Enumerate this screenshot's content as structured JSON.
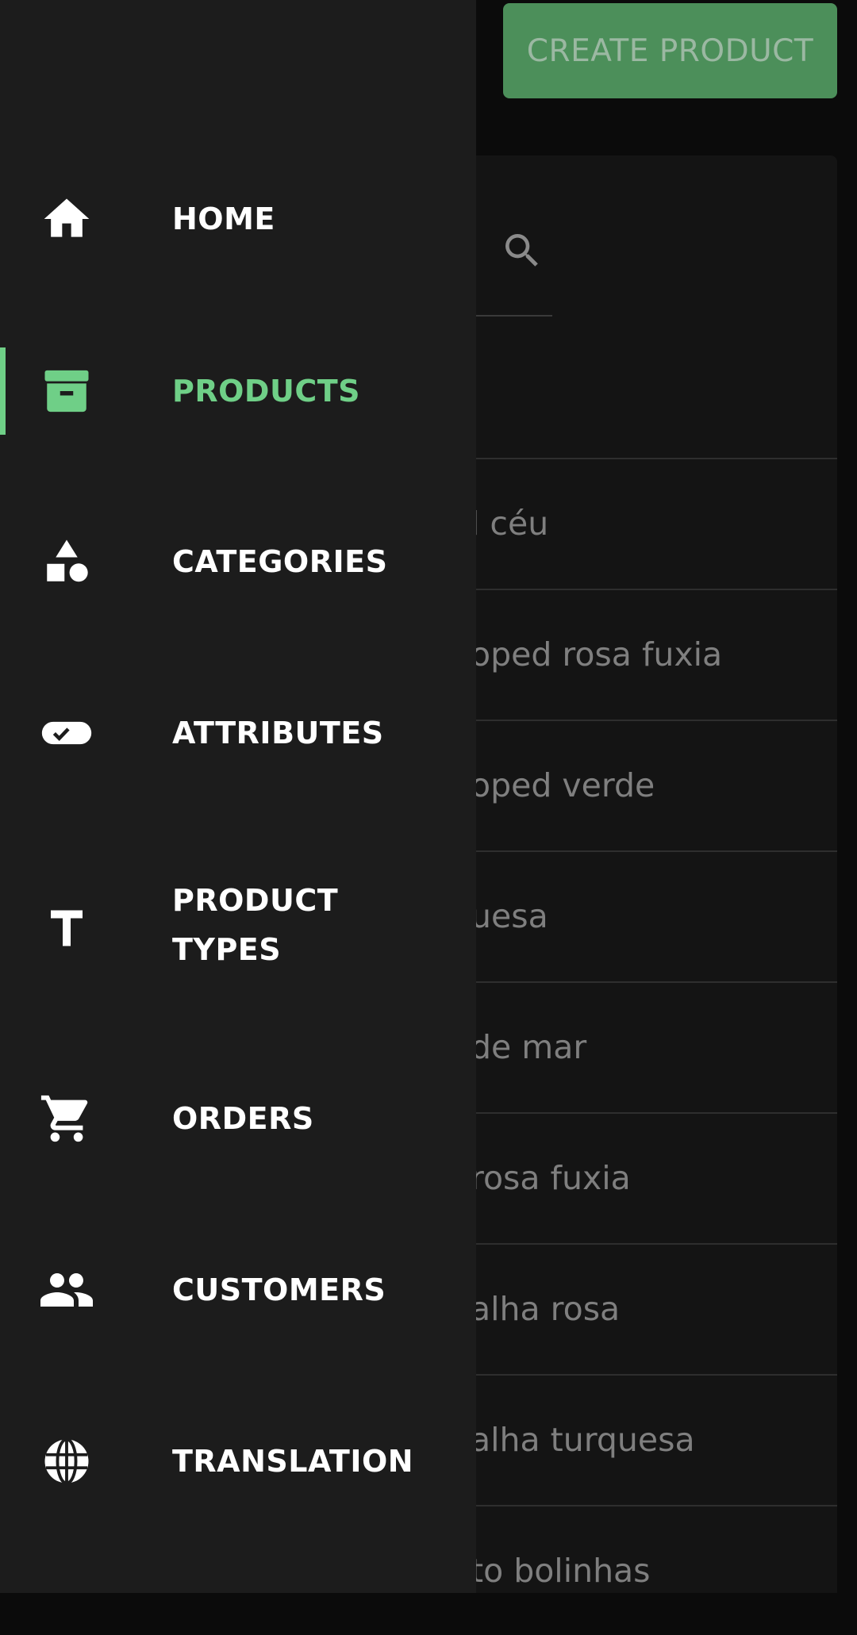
{
  "header": {
    "create_button": "CREATE PRODUCT"
  },
  "products": [
    "l céu",
    "oped rosa fuxia",
    "oped verde",
    "uesa",
    "de mar",
    "rosa fuxia",
    "alha rosa",
    "alha turquesa",
    "to bolinhas"
  ],
  "nav": {
    "items": [
      {
        "label": "HOME",
        "icon": "home-icon"
      },
      {
        "label": "PRODUCTS",
        "icon": "archive-icon",
        "active": true
      },
      {
        "label": "CATEGORIES",
        "icon": "shapes-icon"
      },
      {
        "label": "ATTRIBUTES",
        "icon": "toggle-check-icon"
      },
      {
        "label_line1": "PRODUCT",
        "label_line2": "TYPES",
        "icon": "text-t-icon"
      },
      {
        "label": "ORDERS",
        "icon": "cart-icon"
      },
      {
        "label": "CUSTOMERS",
        "icon": "people-icon"
      },
      {
        "label": "TRANSLATION",
        "icon": "globe-icon"
      }
    ]
  },
  "colors": {
    "accent": "#6fcf87",
    "drawer_bg": "#1c1c1c",
    "button_bg": "#4c8f5a"
  }
}
